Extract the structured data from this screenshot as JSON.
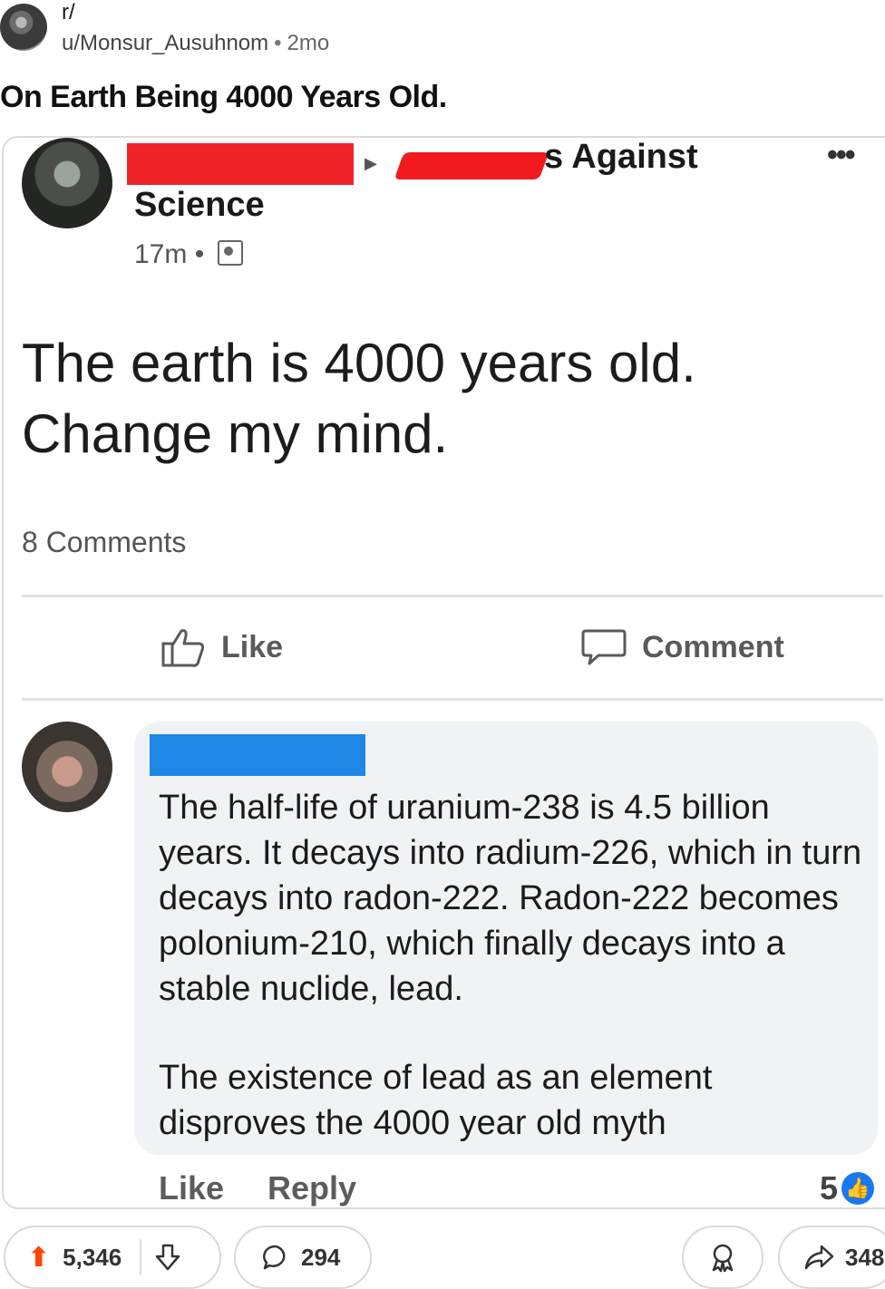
{
  "reddit": {
    "subreddit": "r/",
    "username": "u/Monsur_Ausuhnom",
    "separator": "•",
    "age": "2mo",
    "title": "On Earth Being 4000 Years Old.",
    "votes": "5,346",
    "comments": "294",
    "shares": "348"
  },
  "fb_post": {
    "group_name_tail": "s Against",
    "group_name_line2": "Science",
    "more": "•••",
    "time": "17m",
    "meta_sep": "•",
    "text_line1": "The earth is 4000 years old.",
    "text_line2": "Change my mind.",
    "comments_count": "8 Comments",
    "like_label": "Like",
    "comment_label": "Comment"
  },
  "fb_comment": {
    "paragraph1": "The half-life of uranium-238 is 4.5 billion years. It decays into radium-226, which in turn decays into radon-222. Radon-222 becomes polonium-210, which finally decays into a stable nuclide, lead.",
    "paragraph2": "The existence of lead as an element disproves the 4000 year old myth",
    "like_label": "Like",
    "reply_label": "Reply",
    "reaction_count": "5"
  },
  "colors": {
    "redaction_red": "#f0232b",
    "redaction_blue": "#1e88e5",
    "upvote": "#ff4500",
    "fb_like": "#1877f2"
  }
}
